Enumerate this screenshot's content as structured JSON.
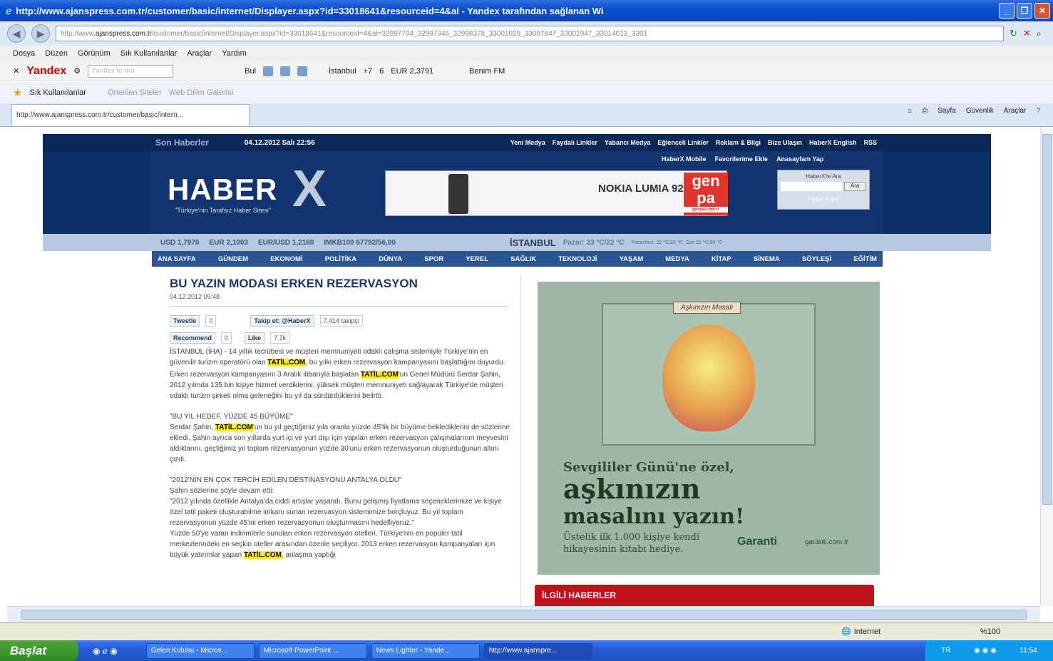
{
  "window": {
    "title": "http://www.ajanspress.com.tr/customer/basic/internet/Displayer.aspx?id=33018641&resourceid=4&al - Yandex tarafından sağlanan Wi"
  },
  "address": {
    "url_prefix": "http://www.",
    "domain": "ajanspress.com.tr",
    "url_rest": "/customer/basic/internet/Displayer.aspx?id=33018641&resourceid=4&al=32997794_32997346_32998378_33001029_33007847_33001947_33014013_3301",
    "search_placeholder": "Yandex"
  },
  "menu": [
    "Dosya",
    "Düzen",
    "Görünüm",
    "Sık Kullanılanlar",
    "Araçlar",
    "Yardım"
  ],
  "yandex": {
    "logo": "Yandex",
    "search": "Yandex'te ara",
    "items": [
      "Bul",
      "İstanbul",
      "+7",
      "6",
      "EUR 2,3791",
      "Benim FM"
    ]
  },
  "favorites": {
    "label": "Sık Kullanılanlar",
    "items": [
      "Önerilen Siteler",
      "Web Dilim Galerisi"
    ]
  },
  "tab": {
    "title": "http://www.ajanspress.com.tr/customer/basic/intern..."
  },
  "commands": [
    "Sayfa",
    "Güvenlik",
    "Araçlar"
  ],
  "site": {
    "son_haberler": "Son Haberler",
    "datetime": "04.12.2012 Salı 22:56",
    "top_links": [
      "Yeni Medya",
      "Faydalı Linkler",
      "Yabancı Medya",
      "Eğlenceli Linkler",
      "Reklam & Bilgi",
      "Bize Ulaşın",
      "HaberX English",
      "RSS"
    ],
    "sub_links": [
      "HaberX Mobile",
      "Favorilerime Ekle",
      "Anasayfam Yap"
    ],
    "logo": "HABER",
    "logo_x": "X",
    "slogan": "\"Türkiye'nin Tarafsız Haber Sitesi\"",
    "ad_text": "NOKIA LUMIA 920",
    "ad_brand": "gen pa",
    "ad_brand_url": "genpa.com.tr",
    "search_label": "HaberX'te Ara",
    "search_btn": "Ara",
    "search_adv": "Haber Arşivi",
    "ticker": {
      "usd": "USD 1,7970",
      "eur": "EUR 2,1003",
      "eurusd": "EUR/USD 1,2160",
      "imkb": "IMKB100 67792/56,00",
      "city": "İSTANBUL",
      "weather": "Pazar: 23 °C/22 °C",
      "forecast": "Pazartesi: 22 °C/20 °C, Salı 22 °C/20 °C"
    },
    "nav": [
      "ANA SAYFA",
      "GÜNDEM",
      "EKONOMİ",
      "POLİTİKA",
      "DÜNYA",
      "SPOR",
      "YEREL",
      "SAĞLIK",
      "TEKNOLOJİ",
      "YAŞAM",
      "MEDYA",
      "KİTAP",
      "SİNEMA",
      "SÖYLEŞİ",
      "EĞİTİM"
    ]
  },
  "article": {
    "title": "BU YAZIN MODASI ERKEN REZERVASYON",
    "date": "04.12.2012 09:48",
    "tweet": "Tweetle",
    "tweet_count": "0",
    "follow": "Takip et: @HaberX",
    "follow_count": "7.414 takipçi",
    "recommend": "Recommend",
    "rec_count": "0",
    "like": "Like",
    "like_count": "7.7k",
    "p1a": "İSTANBUL (İHA) - 14 yıllık tecrübesi ve müşteri memnuniyeti odaklı çalışma sistemiyle Türkiye'nin en güvenilir turizm operatörü olan ",
    "brand": "TATİL.COM",
    "p1b": ", bu yılki erken rezervasyon kampanyasını başlattığını duyurdu.",
    "p2a": "Erken rezervasyon kampanyasını 3 Aralık itibarıyla başlatan ",
    "p2b": "'un Genel Müdürü Serdar Şahin, 2012 yılında 135 bin kişiye hizmet verdiklerini, yüksek müşteri memnuniyeti sağlayarak Türkiye'de müşteri odaklı turizm şirketi olma geleneğini bu yıl da sürdürdüklerini belirtti.",
    "h2": "\"BU YIL HEDEF, YÜZDE 45 BÜYÜME\"",
    "p3a": "Serdar Şahin, ",
    "p3b": "'un bu yıl geçtiğimiz yıla oranla yüzde 45'lik bir büyüme beklediklerini de sözlerine ekledi. Şahin ayrıca son yıllarda yurt içi ve yurt dışı için yapılan erken rezervasyon çalışmalarının meyvesini aldıklarını, geçtiğimiz yıl toplam rezervasyonun yüzde 30'unu erken rezervasyonun oluşturduğunun altını çizdi.",
    "h3": "\"2012'NİN EN ÇOK TERCİH EDİLEN DESTİNASYONU ANTALYA OLDU\"",
    "p4": "Şahin sözlerine şöyle devam etti:",
    "p5": "\"2012 yılında özellikle Antalya'da ciddi artışlar yaşandı. Bunu gelişmiş fiyatlama seçeneklerimize ve kişiye özel tatil paketi oluşturabilme imkanı sunan rezervasyon sistemimize borçluyuz. Bu yıl toplam rezervasyonun yüzde 45'ini erken rezervasyonun oluşturmasını hedefliyoruz.\"",
    "p6a": "Yüzde 50'ye varan indirimlerle sunulan erken rezervasyon otelleri, Türkiye'nin en popüler tatil merkezlerindeki en seçkin oteller arasından özenle seçiliyor. 2013 erken rezervasyon kampanyaları için büyük yatırımlar yapan ",
    "p6b": ", anlaşma yaptığı"
  },
  "ad2": {
    "banner": "Aşkınızın Masalı",
    "line1": "Sevgililer Günü'ne özel,",
    "line2": "aşkınızın",
    "line3": "masalını yazın!",
    "line4": "Üstelik ilk 1.000 kişiye kendi hikayesinin kitabı hediye.",
    "brand": "Garanti",
    "url": "garanti.com.tr"
  },
  "related": "İLGİLİ HABERLER",
  "status": {
    "zone": "Internet",
    "zoom": "%100"
  },
  "taskbar": {
    "start": "Başlat",
    "items": [
      "Gelen Kutusu - Micros...",
      "Microsoft PowerPoint ...",
      "News Lighter - Yande...",
      "http://www.ajanspre..."
    ],
    "lang": "TR",
    "clock": "11:54"
  }
}
